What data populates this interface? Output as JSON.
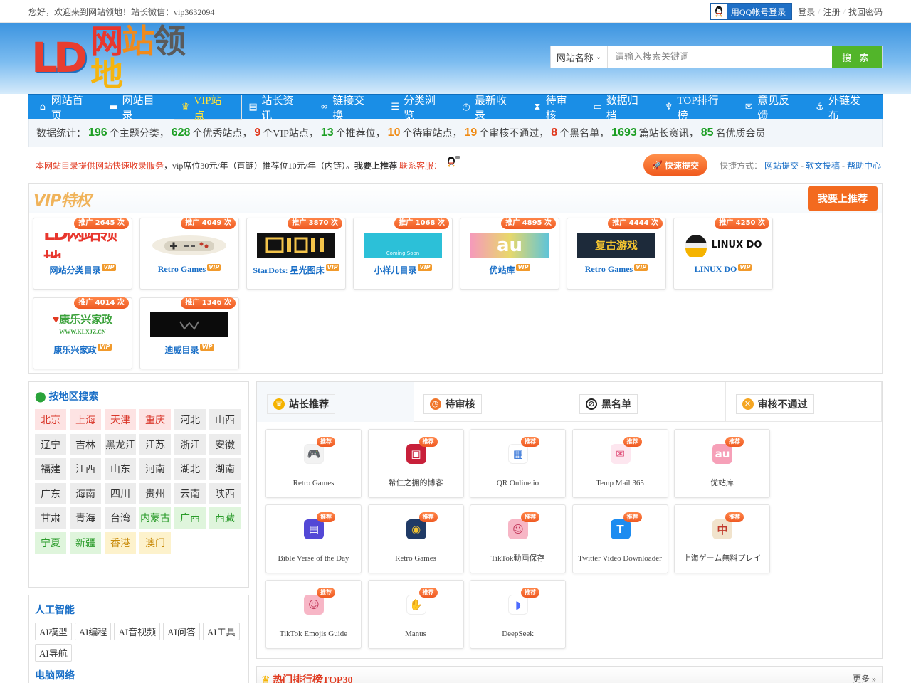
{
  "topbar": {
    "welcome": "您好，欢迎来到网站领地！站长微信：vip3632094",
    "qq_login": "用QQ帐号登录",
    "login": "登录",
    "register": "注册",
    "recover": "找回密码"
  },
  "header": {
    "logo_ld": "LD",
    "logo_text": [
      "网",
      "站",
      "领",
      "地"
    ],
    "search_select": "网站名称",
    "search_placeholder": "请输入搜索关键词",
    "search_button": "搜 索"
  },
  "nav": [
    {
      "label": "网站首页",
      "icon": "home-icon",
      "glyph": "⌂"
    },
    {
      "label": "网站目录",
      "icon": "folder-icon",
      "glyph": "▬"
    },
    {
      "label": "VIP站点",
      "icon": "crown-icon",
      "glyph": "♛"
    },
    {
      "label": "站长资讯",
      "icon": "news-icon",
      "glyph": "▤"
    },
    {
      "label": "链接交换",
      "icon": "link-icon",
      "glyph": "∞"
    },
    {
      "label": "分类浏览",
      "icon": "list-icon",
      "glyph": "☰"
    },
    {
      "label": "最新收录",
      "icon": "clock-icon",
      "glyph": "◷"
    },
    {
      "label": "待审核",
      "icon": "hourglass-icon",
      "glyph": "⧗"
    },
    {
      "label": "数据归档",
      "icon": "archive-icon",
      "glyph": "▭"
    },
    {
      "label": "TOP排行榜",
      "icon": "trophy-icon",
      "glyph": "♆"
    },
    {
      "label": "意见反馈",
      "icon": "comments-icon",
      "glyph": "✉"
    },
    {
      "label": "外链发布",
      "icon": "anchor-icon",
      "glyph": "⚓"
    }
  ],
  "stats": {
    "prefix": "数据统计：",
    "categories": "196",
    "categories_label": "个主题分类，",
    "quality_sites": "628",
    "quality_label": "个优秀站点，",
    "vip_sites": "9",
    "vip_label": "个VIP站点，",
    "recommended": "13",
    "recommended_label": "个推荐位，",
    "pending": "10",
    "pending_label": "个待审站点，",
    "rejected": "19",
    "rejected_label": "个审核不通过，",
    "blacklist": "8",
    "blacklist_label": "个黑名单，",
    "articles": "1693",
    "articles_label": "篇站长资讯，",
    "members": "85",
    "members_label": "名优质会员"
  },
  "notice": {
    "service": "本网站目录提供网站快速收录服务",
    "price": "，vip席位30元/年（直链）推荐位10元/年（内链）。",
    "want": "我要上推荐",
    "contact": "联系客服：",
    "fast_submit": "快速提交",
    "quick_label": "快捷方式：",
    "quick_links": [
      "网站提交",
      "软文投稿",
      "帮助中心"
    ]
  },
  "vip_panel": {
    "label": "VIP特权",
    "recommend_button": "我要上推荐",
    "cards": [
      {
        "name": "网站分类目录",
        "promo": "推广 2645 次",
        "thumb": "ld-logo"
      },
      {
        "name": "Retro Games",
        "promo": "推广 4049 次",
        "thumb": "gamepad"
      },
      {
        "name": "StarDots: 星光图床",
        "promo": "推广 3870 次",
        "thumb": "stardots"
      },
      {
        "name": "小样儿目录",
        "promo": "推广 1068 次",
        "thumb": "xiaoyanger"
      },
      {
        "name": "优站库",
        "promo": "推广 4895 次",
        "thumb": "au"
      },
      {
        "name": "Retro Games",
        "promo": "推广 4444 次",
        "thumb": "retro-cn"
      },
      {
        "name": "LINUX DO",
        "promo": "推广 4250 次",
        "thumb": "linuxdo"
      },
      {
        "name": "康乐兴家政",
        "promo": "推广 4014 次",
        "thumb": "kangle"
      },
      {
        "name": "迪威目录",
        "promo": "推广 1346 次",
        "thumb": "diwei"
      }
    ],
    "vip_tag": "VIP",
    "thumb_text": {
      "ld": "LD网站领地",
      "linux": "LINUX DO",
      "retro_cn": "复古游戏",
      "au": "au",
      "kangle": "康乐兴家政",
      "kangle_url": "WWW.KLXJZ.CN",
      "coming": "Coming Soon"
    }
  },
  "regions": {
    "title": "按地区搜索",
    "items": [
      {
        "name": "北京",
        "style": "pink"
      },
      {
        "name": "上海",
        "style": "pink"
      },
      {
        "name": "天津",
        "style": "pink"
      },
      {
        "name": "重庆",
        "style": "pink"
      },
      {
        "name": "河北",
        "style": "grey"
      },
      {
        "name": "山西",
        "style": "grey"
      },
      {
        "name": "辽宁",
        "style": "grey"
      },
      {
        "name": "吉林",
        "style": "grey"
      },
      {
        "name": "黑龙江",
        "style": "grey"
      },
      {
        "name": "江苏",
        "style": "grey"
      },
      {
        "name": "浙江",
        "style": "grey"
      },
      {
        "name": "安徽",
        "style": "grey"
      },
      {
        "name": "福建",
        "style": "grey"
      },
      {
        "name": "江西",
        "style": "grey"
      },
      {
        "name": "山东",
        "style": "grey"
      },
      {
        "name": "河南",
        "style": "grey"
      },
      {
        "name": "湖北",
        "style": "grey"
      },
      {
        "name": "湖南",
        "style": "grey"
      },
      {
        "name": "广东",
        "style": "grey"
      },
      {
        "name": "海南",
        "style": "grey"
      },
      {
        "name": "四川",
        "style": "grey"
      },
      {
        "name": "贵州",
        "style": "grey"
      },
      {
        "name": "云南",
        "style": "grey"
      },
      {
        "name": "陕西",
        "style": "grey"
      },
      {
        "name": "甘肃",
        "style": "grey"
      },
      {
        "name": "青海",
        "style": "grey"
      },
      {
        "name": "台湾",
        "style": "grey"
      },
      {
        "name": "内蒙古",
        "style": "green"
      },
      {
        "name": "广西",
        "style": "green"
      },
      {
        "name": "西藏",
        "style": "green"
      },
      {
        "name": "宁夏",
        "style": "green"
      },
      {
        "name": "新疆",
        "style": "green"
      },
      {
        "name": "香港",
        "style": "yellow"
      },
      {
        "name": "澳门",
        "style": "yellow"
      }
    ]
  },
  "categories": {
    "ai_title": "人工智能",
    "ai_tags": [
      "AI模型",
      "AI编程",
      "AI音视频",
      "AI问答",
      "AI工具",
      "AI导航"
    ],
    "pc_title": "电脑网络"
  },
  "tabs": [
    {
      "label": "站长推荐",
      "icon": "crown-icon",
      "color": "#f5b300"
    },
    {
      "label": "待审核",
      "icon": "clock-icon",
      "color": "#f0762a"
    },
    {
      "label": "黑名单",
      "icon": "ban-icon",
      "color": "#333333"
    },
    {
      "label": "审核不通过",
      "icon": "close-circle-icon",
      "color": "#f5a623"
    }
  ],
  "recommend": {
    "badge": "推荐",
    "items": [
      {
        "name": "Retro Games",
        "glyph": "🎮",
        "bg": "#f2f2f2",
        "fg": "#555555"
      },
      {
        "name": "希仁之拥的博客",
        "glyph": "▣",
        "bg": "#c8203a",
        "fg": "#ffffff"
      },
      {
        "name": "QR Online.io",
        "glyph": "▦",
        "bg": "#ffffff",
        "fg": "#2d6fd6"
      },
      {
        "name": "Temp Mail 365",
        "glyph": "✉",
        "bg": "#fde6ef",
        "fg": "#e0507a"
      },
      {
        "name": "优站库",
        "glyph": "au",
        "bg": "#f6a0b8",
        "fg": "#ffffff"
      },
      {
        "name": "Bible Verse of the Day",
        "glyph": "▤",
        "bg": "#5348d6",
        "fg": "#ffffff"
      },
      {
        "name": "Retro Games",
        "glyph": "◉",
        "bg": "#1f3a66",
        "fg": "#f4c430"
      },
      {
        "name": "TikTok動画保存",
        "glyph": "☺",
        "bg": "#f7b6c6",
        "fg": "#c2385a"
      },
      {
        "name": "Twitter Video Downloader",
        "glyph": "T",
        "bg": "#1d8cf0",
        "fg": "#ffffff"
      },
      {
        "name": "上海ゲーム無料プレイ",
        "glyph": "中",
        "bg": "#f1e3cc",
        "fg": "#c0392b"
      },
      {
        "name": "TikTok Emojis Guide",
        "glyph": "☺",
        "bg": "#f7b6c6",
        "fg": "#c2385a"
      },
      {
        "name": "Manus",
        "glyph": "✋",
        "bg": "#ffffff",
        "fg": "#222222"
      },
      {
        "name": "DeepSeek",
        "glyph": "◗",
        "bg": "#ffffff",
        "fg": "#4d6bfe"
      }
    ]
  },
  "hot": {
    "title": "热门排行榜TOP30",
    "more": "更多 »"
  }
}
